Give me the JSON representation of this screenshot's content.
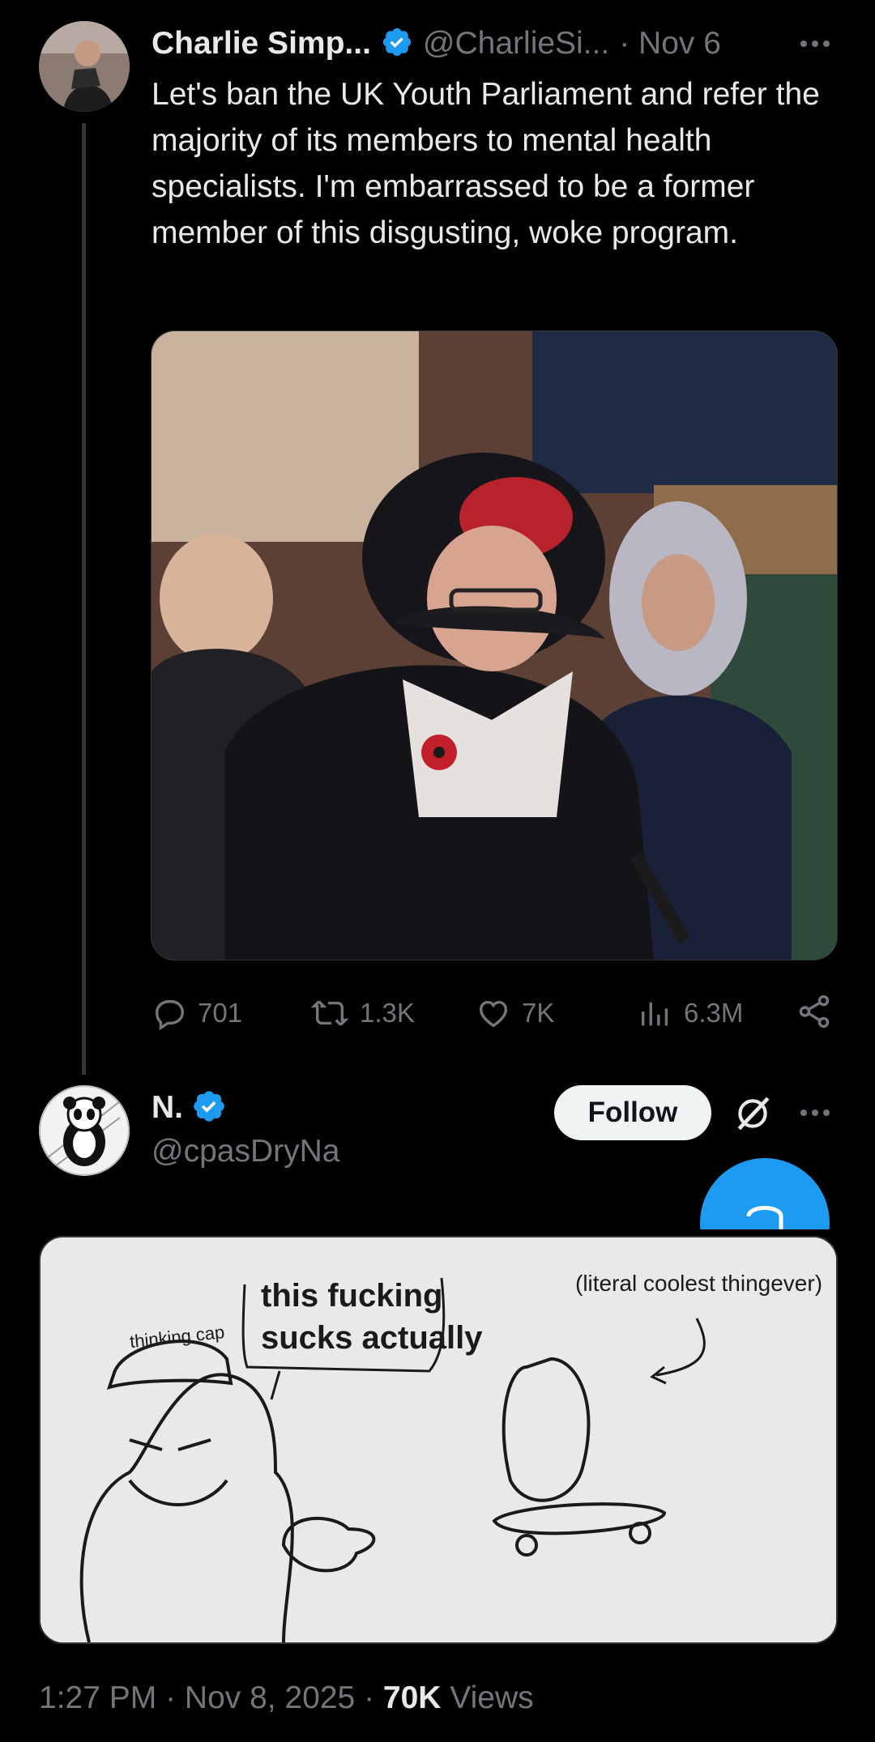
{
  "parent_tweet": {
    "display_name": "Charlie Simp...",
    "handle": "@CharlieSi...",
    "time": "· Nov 6",
    "text": "Let's ban the UK Youth Parliament and refer the majority of its members to mental health specialists. I'm embarrassed to be a former member of this disgusting, woke program.",
    "stats": {
      "replies": "701",
      "reposts": "1.3K",
      "likes": "7K",
      "views": "6.3M"
    }
  },
  "reply_tweet": {
    "display_name": "N.",
    "handle": "@cpasDryNa",
    "follow_label": "Follow",
    "meme": {
      "cap_label": "thinking cap",
      "speech_bubble": "this fucking sucks actually",
      "caption": "(literal coolest thingever)"
    },
    "footer": {
      "time": "1:27 PM",
      "date": "Nov 8, 2025",
      "views_count": "70K",
      "views_label": "Views"
    }
  },
  "colors": {
    "background": "#000000",
    "text": "#e7e9ea",
    "muted": "#71767b",
    "verified": "#1d9bf0",
    "accent": "#1d9bf0"
  }
}
